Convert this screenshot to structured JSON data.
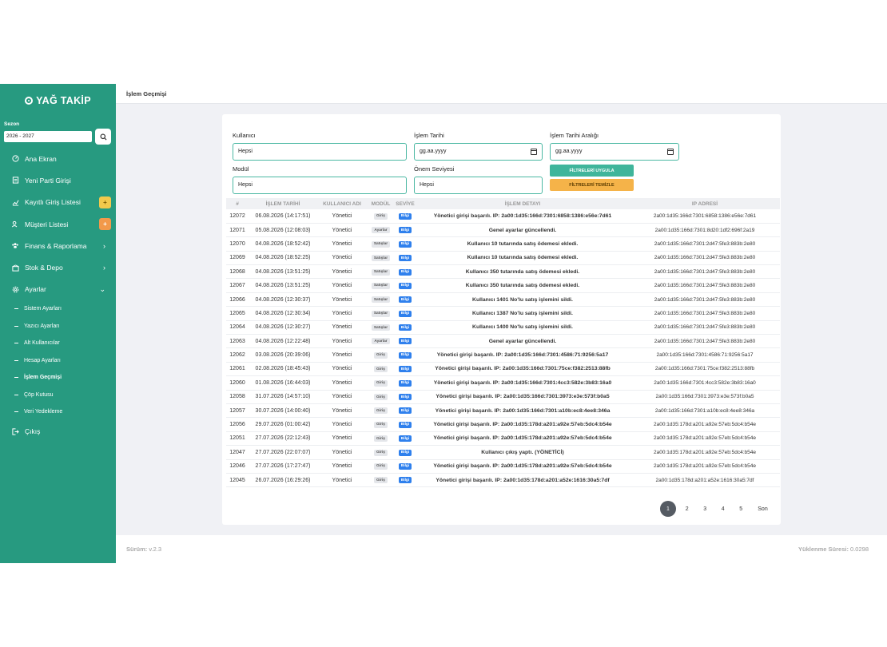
{
  "brand": {
    "name": "YAĞ TAKİP"
  },
  "season": {
    "label": "Sezon",
    "value": "2026 - 2027"
  },
  "sidebar": {
    "items": [
      {
        "label": "Ana Ekran"
      },
      {
        "label": "Yeni Parti Girişi"
      },
      {
        "label": "Kayıtlı Giriş Listesi"
      },
      {
        "label": "Müşteri Listesi"
      },
      {
        "label": "Finans & Raporlama"
      },
      {
        "label": "Stok & Depo"
      },
      {
        "label": "Ayarlar"
      }
    ],
    "sub": [
      {
        "label": "Sistem Ayarları"
      },
      {
        "label": "Yazıcı Ayarları"
      },
      {
        "label": "Alt Kullanıcılar"
      },
      {
        "label": "Hesap Ayarları"
      },
      {
        "label": "İşlem Geçmişi"
      },
      {
        "label": "Çöp Kutusu"
      },
      {
        "label": "Veri Yedekleme"
      }
    ],
    "logout": "Çıkış"
  },
  "page": {
    "title": "İşlem Geçmişi"
  },
  "filters": {
    "user_label": "Kullanıcı",
    "user_value": "Hepsi",
    "date_label": "İşlem Tarihi",
    "date_value": "gg.aa.yyyy",
    "range_label": "İşlem Tarihi Aralığı",
    "range_value": "gg.aa.yyyy",
    "module_label": "Modül",
    "module_value": "Hepsi",
    "level_label": "Önem Seviyesi",
    "level_value": "Hepsi",
    "apply": "FİLTRELERİ UYGULA",
    "clear": "FİLTRELERİ TEMİZLE"
  },
  "table": {
    "headers": [
      "#",
      "İŞLEM TARİHİ",
      "KULLANICI ADI",
      "MODÜL",
      "SEVİYE",
      "İŞLEM DETAYI",
      "IP ADRESİ"
    ],
    "rows": [
      [
        "12072",
        "06.08.2026 (14:17:51)",
        "Yönetici",
        "Giriş",
        "Bilgi",
        "Yönetici girişi başarılı. IP: 2a00:1d35:166d:7301:6858:1386:e56e:7d61",
        "2a00:1d35:166d:7301:6858:1386:e56e:7d61"
      ],
      [
        "12071",
        "05.08.2026 (12:08:03)",
        "Yönetici",
        "Ayarlar",
        "Bilgi",
        "Genel ayarlar güncellendi.",
        "2a00:1d35:166d:7301:8d20:1df2:696f:2a19"
      ],
      [
        "12070",
        "04.08.2026 (18:52:42)",
        "Yönetici",
        "Satışlar",
        "Bilgi",
        "Kullanıcı 10 tutarında satış ödemesi ekledi.",
        "2a00:1d35:166d:7301:2d47:5fe3:883b:2e80"
      ],
      [
        "12069",
        "04.08.2026 (18:52:25)",
        "Yönetici",
        "Satışlar",
        "Bilgi",
        "Kullanıcı 10 tutarında satış ödemesi ekledi.",
        "2a00:1d35:166d:7301:2d47:5fe3:883b:2e80"
      ],
      [
        "12068",
        "04.08.2026 (13:51:25)",
        "Yönetici",
        "Satışlar",
        "Bilgi",
        "Kullanıcı 350 tutarında satış ödemesi ekledi.",
        "2a00:1d35:166d:7301:2d47:5fe3:883b:2e80"
      ],
      [
        "12067",
        "04.08.2026 (13:51:25)",
        "Yönetici",
        "Satışlar",
        "Bilgi",
        "Kullanıcı 350 tutarında satış ödemesi ekledi.",
        "2a00:1d35:166d:7301:2d47:5fe3:883b:2e80"
      ],
      [
        "12066",
        "04.08.2026 (12:30:37)",
        "Yönetici",
        "Satışlar",
        "Bilgi",
        "Kullanıcı 1401 No'lu satış işlemini sildi.",
        "2a00:1d35:166d:7301:2d47:5fe3:883b:2e80"
      ],
      [
        "12065",
        "04.08.2026 (12:30:34)",
        "Yönetici",
        "Satışlar",
        "Bilgi",
        "Kullanıcı 1387 No'lu satış işlemini sildi.",
        "2a00:1d35:166d:7301:2d47:5fe3:883b:2e80"
      ],
      [
        "12064",
        "04.08.2026 (12:30:27)",
        "Yönetici",
        "Satışlar",
        "Bilgi",
        "Kullanıcı 1400 No'lu satış işlemini sildi.",
        "2a00:1d35:166d:7301:2d47:5fe3:883b:2e80"
      ],
      [
        "12063",
        "04.08.2026 (12:22:48)",
        "Yönetici",
        "Ayarlar",
        "Bilgi",
        "Genel ayarlar güncellendi.",
        "2a00:1d35:166d:7301:2d47:5fe3:883b:2e80"
      ],
      [
        "12062",
        "03.08.2026 (20:39:06)",
        "Yönetici",
        "Giriş",
        "Bilgi",
        "Yönetici girişi başarılı. IP: 2a00:1d35:166d:7301:4586:71:9256:5a17",
        "2a00:1d35:166d:7301:4586:71:9256:5a17"
      ],
      [
        "12061",
        "02.08.2026 (18:45:43)",
        "Yönetici",
        "Giriş",
        "Bilgi",
        "Yönetici girişi başarılı. IP: 2a00:1d35:166d:7301:75ce:f382:2513:88fb",
        "2a00:1d35:166d:7301:75ce:f382:2513:88fb"
      ],
      [
        "12060",
        "01.08.2026 (16:44:03)",
        "Yönetici",
        "Giriş",
        "Bilgi",
        "Yönetici girişi başarılı. IP: 2a00:1d35:166d:7301:4cc3:582e:3b83:16a0",
        "2a00:1d35:166d:7301:4cc3:582e:3b83:16a0"
      ],
      [
        "12058",
        "31.07.2026 (14:57:10)",
        "Yönetici",
        "Giriş",
        "Bilgi",
        "Yönetici girişi başarılı. IP: 2a00:1d35:166d:7301:3973:e3e:573f:b0a5",
        "2a00:1d35:166d:7301:3973:e3e:573f:b0a5"
      ],
      [
        "12057",
        "30.07.2026 (14:00:40)",
        "Yönetici",
        "Giriş",
        "Bilgi",
        "Yönetici girişi başarılı. IP: 2a00:1d35:166d:7301:a10b:ec8:4ee8:346a",
        "2a00:1d35:166d:7301:a10b:ec8:4ee8:346a"
      ],
      [
        "12056",
        "29.07.2026 (01:00:42)",
        "Yönetici",
        "Giriş",
        "Bilgi",
        "Yönetici girişi başarılı. IP: 2a00:1d35:178d:a201:a92e:57eb:5dc4:b54e",
        "2a00:1d35:178d:a201:a92e:57eb:5dc4:b54e"
      ],
      [
        "12051",
        "27.07.2026 (22:12:43)",
        "Yönetici",
        "Giriş",
        "Bilgi",
        "Yönetici girişi başarılı. IP: 2a00:1d35:178d:a201:a92e:57eb:5dc4:b54e",
        "2a00:1d35:178d:a201:a92e:57eb:5dc4:b54e"
      ],
      [
        "12047",
        "27.07.2026 (22:07:07)",
        "Yönetici",
        "Giriş",
        "Bilgi",
        "Kullanıcı çıkış yaptı. (YÖNETİCİ)",
        "2a00:1d35:178d:a201:a92e:57eb:5dc4:b54e"
      ],
      [
        "12046",
        "27.07.2026 (17:27:47)",
        "Yönetici",
        "Giriş",
        "Bilgi",
        "Yönetici girişi başarılı. IP: 2a00:1d35:178d:a201:a92e:57eb:5dc4:b54e",
        "2a00:1d35:178d:a201:a92e:57eb:5dc4:b54e"
      ],
      [
        "12045",
        "26.07.2026 (16:29:26)",
        "Yönetici",
        "Giriş",
        "Bilgi",
        "Yönetici girişi başarılı. IP: 2a00:1d35:178d:a201:a52e:1616:30a5:7df",
        "2a00:1d35:178d:a201:a52e:1616:30a5:7df"
      ]
    ]
  },
  "pagination": {
    "pages": [
      "1",
      "2",
      "3",
      "4",
      "5"
    ],
    "last": "Son",
    "current": "1"
  },
  "footer": {
    "version_label": "Sürüm:",
    "version": "v.2.3",
    "load_label": "Yüklenme Süresi:",
    "load": "0.0298"
  },
  "colors": {
    "sidebar": "#279a80",
    "accent": "#4bb8a3",
    "apply": "#3fb59b",
    "clear": "#f5b349",
    "level": "#2f80ed"
  }
}
